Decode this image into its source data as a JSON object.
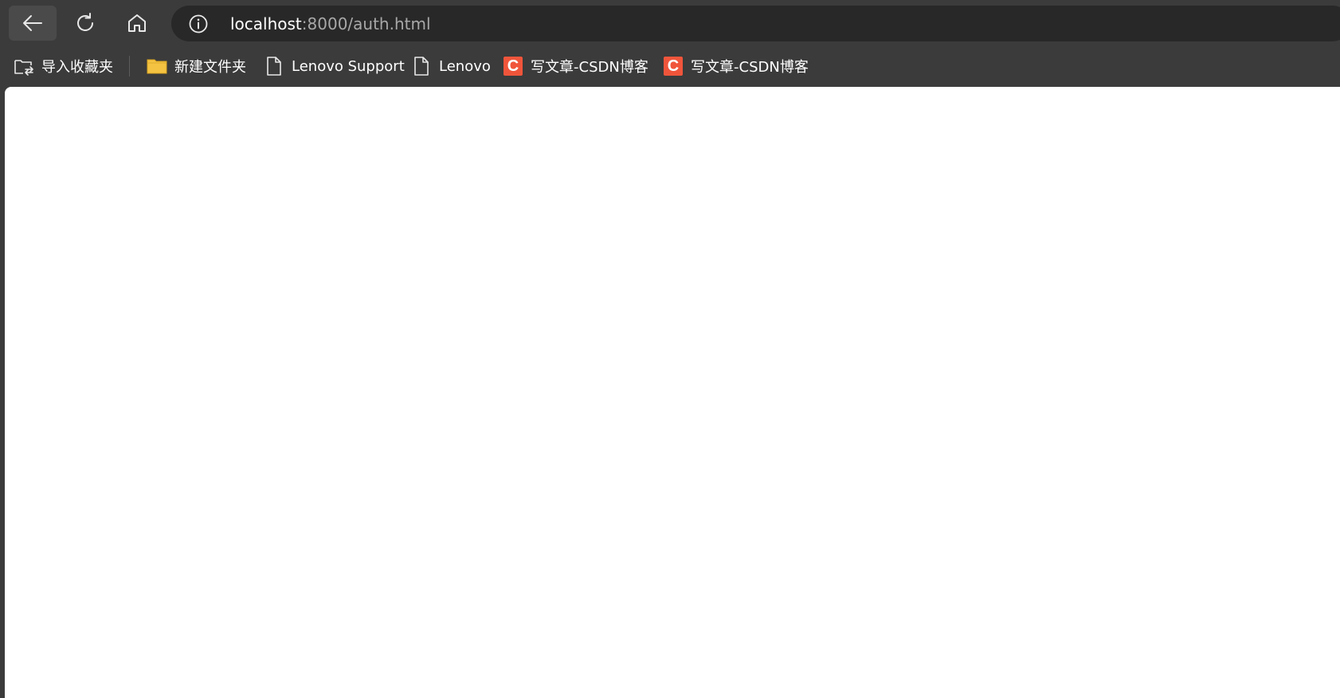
{
  "toolbar": {
    "back_icon": "arrow-left-icon",
    "reload_icon": "reload-icon",
    "home_icon": "home-icon"
  },
  "address_bar": {
    "site_info_icon": "info-icon",
    "url_host": "localhost",
    "url_rest": ":8000/auth.html"
  },
  "bookmarks": {
    "import": {
      "label": "导入收藏夹",
      "icon": "import-favorites-icon"
    },
    "items": [
      {
        "label": "新建文件夹",
        "icon": "folder-icon"
      },
      {
        "label": "Lenovo Support",
        "icon": "page-icon"
      },
      {
        "label": "Lenovo",
        "icon": "page-icon"
      },
      {
        "label": "写文章-CSDN博客",
        "icon": "csdn-icon",
        "icon_letter": "C"
      },
      {
        "label": "写文章-CSDN博客",
        "icon": "csdn-icon",
        "icon_letter": "C"
      }
    ]
  },
  "colors": {
    "chrome_bg": "#3b3b3b",
    "address_bg": "#282828",
    "csdn_brand": "#f0553b",
    "folder_yellow": "#f5c342",
    "page_bg": "#ffffff"
  }
}
